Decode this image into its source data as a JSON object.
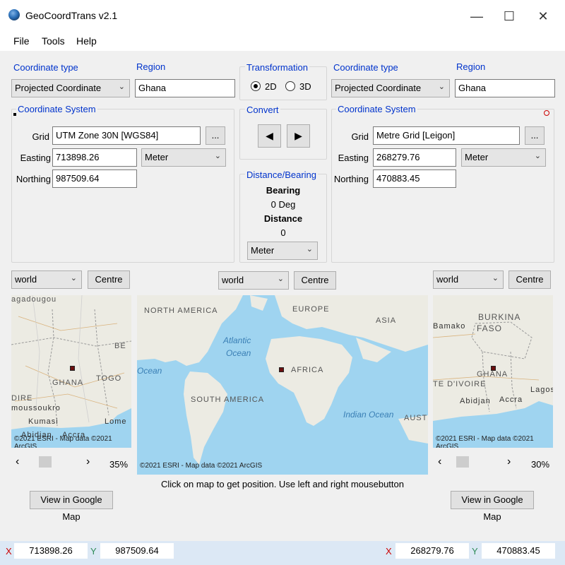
{
  "window": {
    "title": "GeoCoordTrans v2.1",
    "minimize": "—",
    "maximize": "☐",
    "close": "✕"
  },
  "menu": [
    "File",
    "Tools",
    "Help"
  ],
  "left": {
    "coord_type_label": "Coordinate type",
    "coord_type_value": "Projected Coordinate",
    "region_label": "Region",
    "region_value": "Ghana",
    "cs_title": "Coordinate System",
    "grid_label": "Grid",
    "grid_value": "UTM Zone 30N [WGS84]",
    "browse": "...",
    "easting_label": "Easting",
    "easting_value": "713898.26",
    "easting_unit": "Meter",
    "northing_label": "Northing",
    "northing_value": "987509.64"
  },
  "middle": {
    "transformation_title": "Transformation",
    "opt_2d": "2D",
    "opt_3d": "3D",
    "convert_title": "Convert",
    "left_arrow": "◀",
    "right_arrow": "▶",
    "distbear_title": "Distance/Bearing",
    "bearing_label": "Bearing",
    "bearing_value": "0 Deg",
    "distance_label": "Distance",
    "distance_value": "0",
    "unit": "Meter"
  },
  "right": {
    "coord_type_label": "Coordinate type",
    "coord_type_value": "Projected Coordinate",
    "region_label": "Region",
    "region_value": "Ghana",
    "cs_title": "Coordinate System",
    "grid_label": "Grid",
    "grid_value": "Metre Grid [Leigon]",
    "browse": "...",
    "easting_label": "Easting",
    "easting_value": "268279.76",
    "easting_unit": "Meter",
    "northing_label": "Northing",
    "northing_value": "470883.45"
  },
  "maps": {
    "left_extent": "world",
    "mid_extent": "world",
    "right_extent": "world",
    "centre": "Centre",
    "left_zoom": "35%",
    "right_zoom": "30%",
    "scroll_left": "‹",
    "scroll_right": "›",
    "credit": "©2021 ESRI - Map data ©2021 ArcGIS",
    "left_labels": [
      "agadougou",
      "BE",
      "GHANA",
      "TOGO",
      "DIRE",
      "moussoukro",
      "Kumasi",
      "Lome",
      "Abidjan",
      "Accra"
    ],
    "mid_labels": [
      "NORTH AMERICA",
      "EUROPE",
      "ASIA",
      "Atlantic",
      "Ocean",
      "Ocean",
      "AFRICA",
      "SOUTH AMERICA",
      "Indian Ocean",
      "AUSTR"
    ],
    "right_labels": [
      "BURKINA",
      "FASO",
      "Bamako",
      "GHANA",
      "TE D'IVOIRE",
      "Abidjan",
      "Accra",
      "Lagos"
    ],
    "hint": "Click on map to get position. Use left and right mousebutton",
    "view_google": "View in Google Map"
  },
  "status": {
    "x_label": "X",
    "y_label": "Y",
    "left_x": "713898.26",
    "left_y": "987509.64",
    "right_x": "268279.76",
    "right_y": "470883.45"
  }
}
